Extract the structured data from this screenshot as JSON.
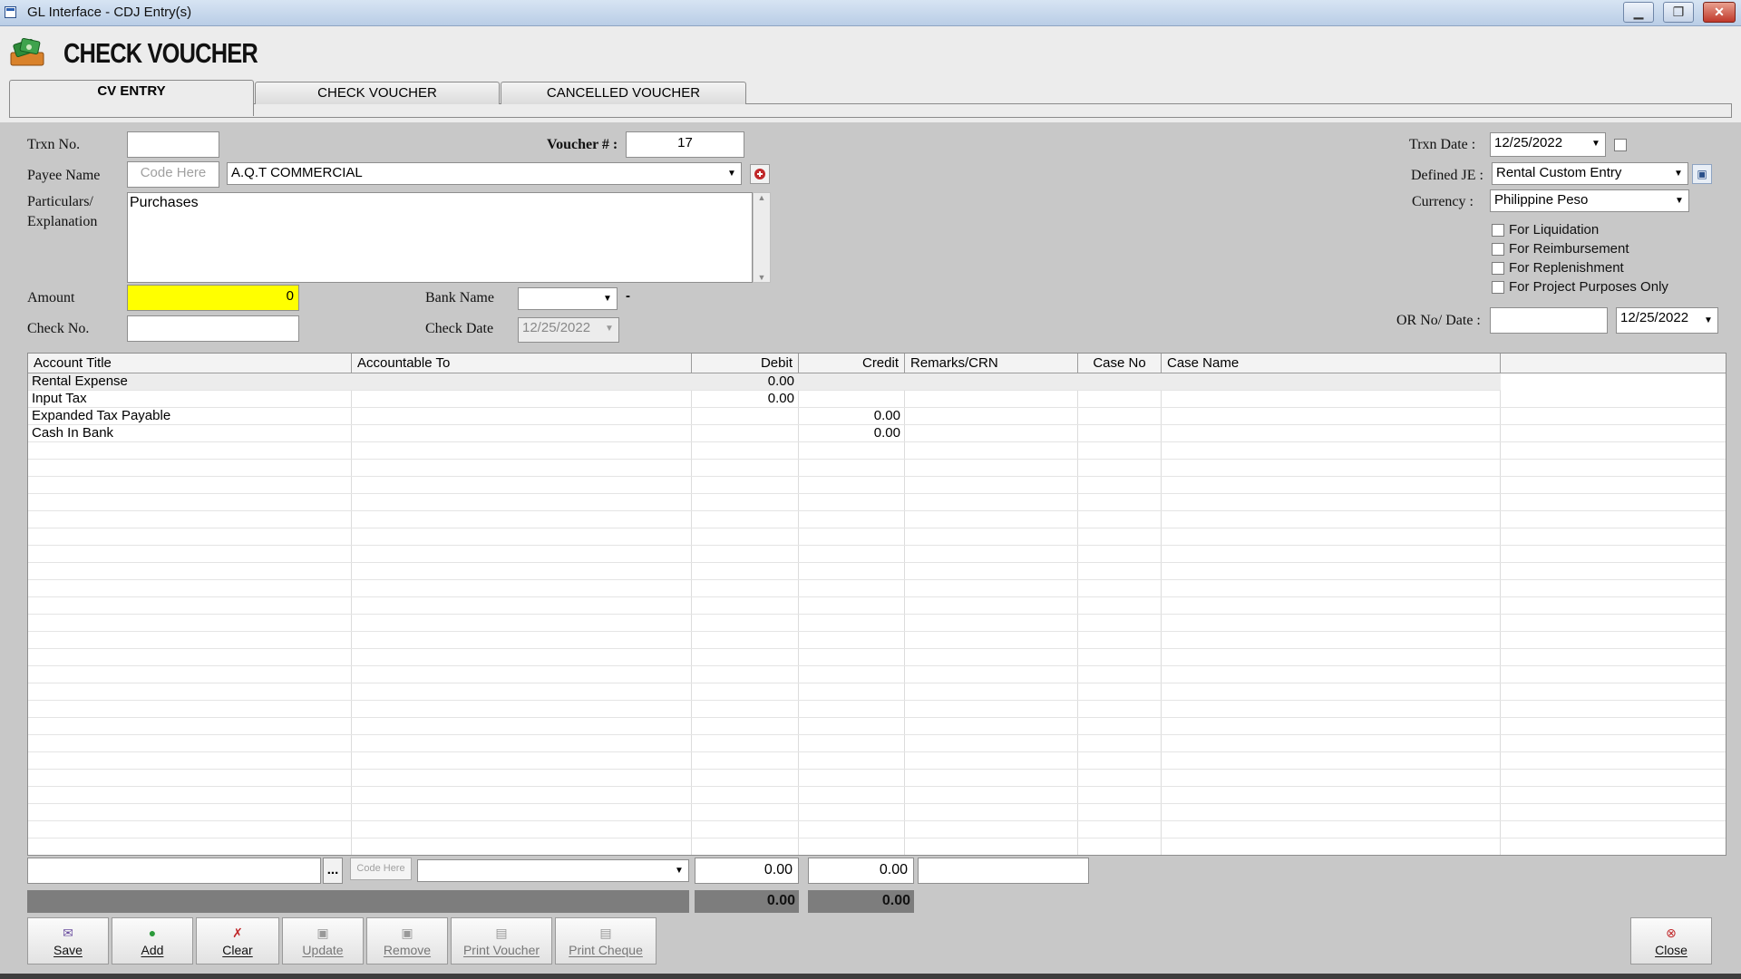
{
  "window": {
    "title": "GL Interface - CDJ Entry(s)"
  },
  "header": {
    "heading": "CHECK VOUCHER"
  },
  "tabs": [
    {
      "label": "CV ENTRY"
    },
    {
      "label": "CHECK  VOUCHER"
    },
    {
      "label": "CANCELLED VOUCHER"
    }
  ],
  "form": {
    "trxn_no_label": "Trxn No.",
    "trxn_no": "",
    "voucher_label": "Voucher # :",
    "voucher_no": "17",
    "payee_label": "Payee Name",
    "payee_code_placeholder": "Code Here",
    "payee_name": "A.Q.T COMMERCIAL",
    "particulars_label_1": "Particulars/",
    "particulars_label_2": "Explanation",
    "particulars": "Purchases",
    "amount_label": "Amount",
    "amount": "0",
    "bank_name_label": "Bank Name",
    "bank_name": "",
    "bank_suffix": "-",
    "check_no_label": "Check No.",
    "check_no": "",
    "check_date_label": "Check Date",
    "check_date": "12/25/2022",
    "trxn_date_label": "Trxn Date :",
    "trxn_date": "12/25/2022",
    "defined_je_label": "Defined JE :",
    "defined_je": "Rental Custom Entry",
    "currency_label": "Currency :",
    "currency": "Philippine Peso",
    "checkboxes": [
      {
        "label": "For Liquidation"
      },
      {
        "label": "For Reimbursement"
      },
      {
        "label": "For Replenishment"
      },
      {
        "label": "For Project Purposes Only"
      }
    ],
    "or_label": "OR No/ Date :",
    "or_no": "",
    "or_date": "12/25/2022"
  },
  "grid": {
    "columns": [
      "Account Title",
      "Accountable To",
      "Debit",
      "Credit",
      "Remarks/CRN",
      "Case No",
      "Case Name"
    ],
    "rows": [
      {
        "account": "Rental Expense",
        "accountable": "",
        "debit": "0.00",
        "credit": ""
      },
      {
        "account": "Input Tax",
        "accountable": "",
        "debit": "0.00",
        "credit": ""
      },
      {
        "account": "Expanded Tax Payable",
        "accountable": "",
        "debit": "",
        "credit": "0.00"
      },
      {
        "account": "Cash In Bank",
        "accountable": "",
        "debit": "",
        "credit": "0.00"
      }
    ]
  },
  "entry": {
    "browse_label": "...",
    "code_placeholder": "Code Here",
    "debit": "0.00",
    "credit": "0.00"
  },
  "totals": {
    "debit": "0.00",
    "credit": "0.00"
  },
  "buttons": {
    "save": "Save",
    "add": "Add",
    "clear": "Clear",
    "update": "Update",
    "remove": "Remove",
    "print_voucher": "Print Voucher",
    "print_cheque": "Print Cheque",
    "close": "Close"
  },
  "colors": {
    "amount_highlight": "#ffff00",
    "grid_selected_row": "#ececec"
  }
}
